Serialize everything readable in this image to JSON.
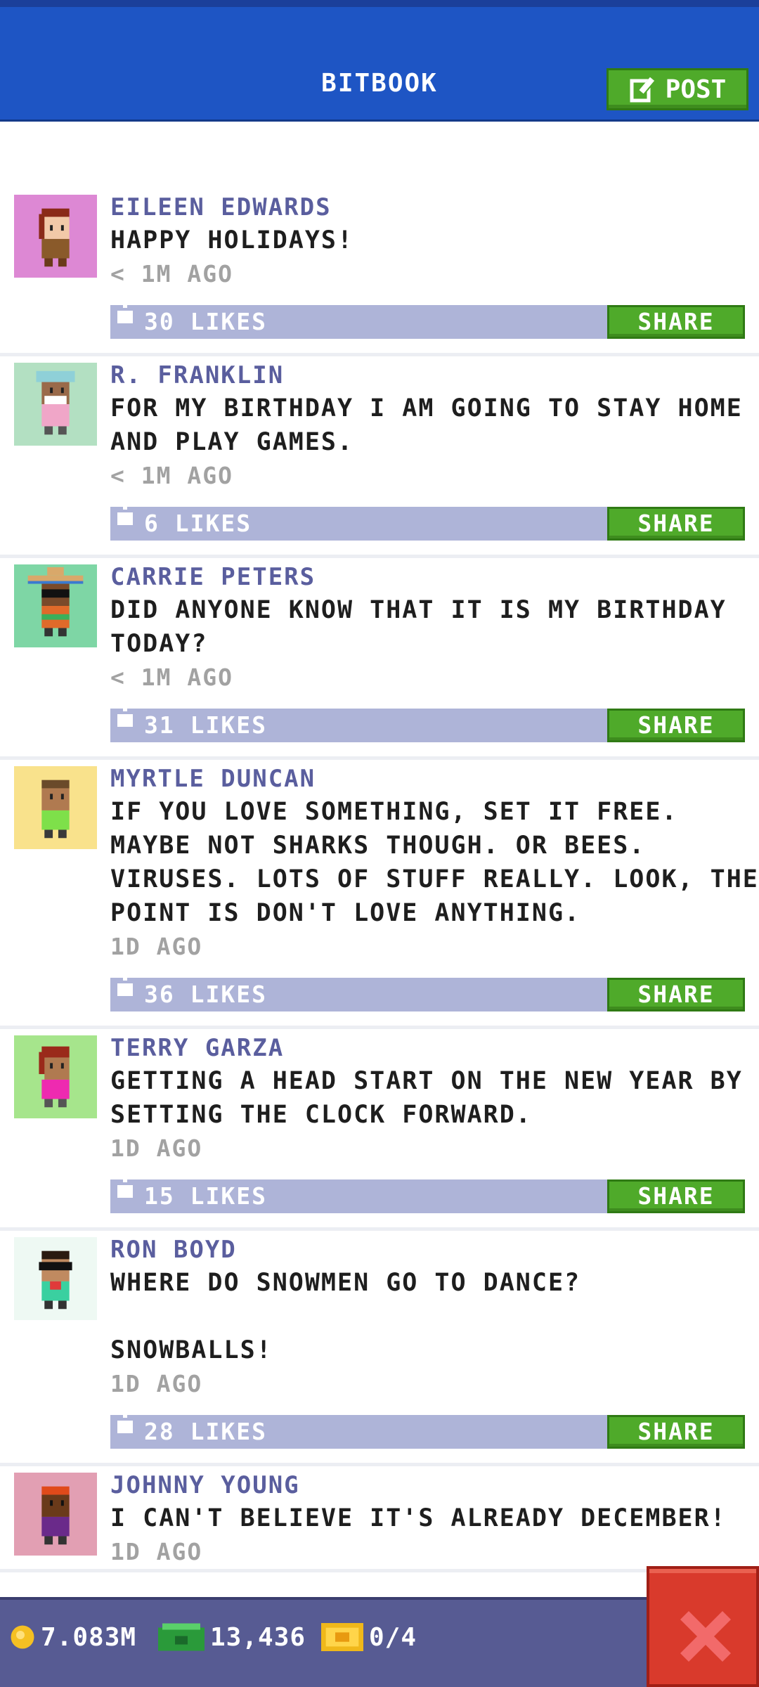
{
  "app": {
    "title": "BITBOOK"
  },
  "toolbar": {
    "post_label": "POST"
  },
  "feed": {
    "posts": [
      {
        "author": "EILEEN EDWARDS",
        "message": "HAPPY HOLIDAYS!",
        "time": "< 1M AGO",
        "likes": "30 LIKES",
        "share_label": "SHARE",
        "avatar_bg": "#dd88d4"
      },
      {
        "author": "R. FRANKLIN",
        "message": "FOR MY BIRTHDAY I AM GOING TO STAY HOME AND PLAY GAMES.",
        "time": "< 1M AGO",
        "likes": "6 LIKES",
        "share_label": "SHARE",
        "avatar_bg": "#b3e0c2"
      },
      {
        "author": "CARRIE PETERS",
        "message": "DID ANYONE KNOW THAT IT IS MY BIRTHDAY TODAY?",
        "time": "< 1M AGO",
        "likes": "31 LIKES",
        "share_label": "SHARE",
        "avatar_bg": "#7ed6a5"
      },
      {
        "author": "MYRTLE DUNCAN",
        "message": "IF YOU LOVE SOMETHING, SET IT FREE. MAYBE NOT SHARKS THOUGH. OR BEES. VIRUSES. LOTS OF STUFF REALLY. LOOK, THE POINT IS DON'T LOVE ANYTHING.",
        "time": "1D AGO",
        "likes": "36 LIKES",
        "share_label": "SHARE",
        "avatar_bg": "#f9e28c"
      },
      {
        "author": "TERRY GARZA",
        "message": "GETTING A HEAD START ON THE NEW YEAR BY SETTING THE CLOCK FORWARD.",
        "time": "1D AGO",
        "likes": "15 LIKES",
        "share_label": "SHARE",
        "avatar_bg": "#a6e58c"
      },
      {
        "author": "RON BOYD",
        "message": "WHERE DO SNOWMEN GO TO DANCE?\n\nSNOWBALLS!",
        "time": "1D AGO",
        "likes": "28 LIKES",
        "share_label": "SHARE",
        "avatar_bg": "#eef9f3"
      },
      {
        "author": "JOHNNY YOUNG",
        "message": "I CAN'T BELIEVE IT'S ALREADY DECEMBER!",
        "time": "1D AGO",
        "likes": "",
        "share_label": "",
        "avatar_bg": "#e29fb3"
      }
    ]
  },
  "footer": {
    "coins": "7.083M",
    "bux": "13,436",
    "tickets": "0/4"
  },
  "colors": {
    "header_blue": "#1e55c4",
    "post_green": "#4faa2a",
    "author_purple": "#5a5e9e",
    "likebar": "#aeb4d8",
    "close_red": "#d93a2c"
  }
}
